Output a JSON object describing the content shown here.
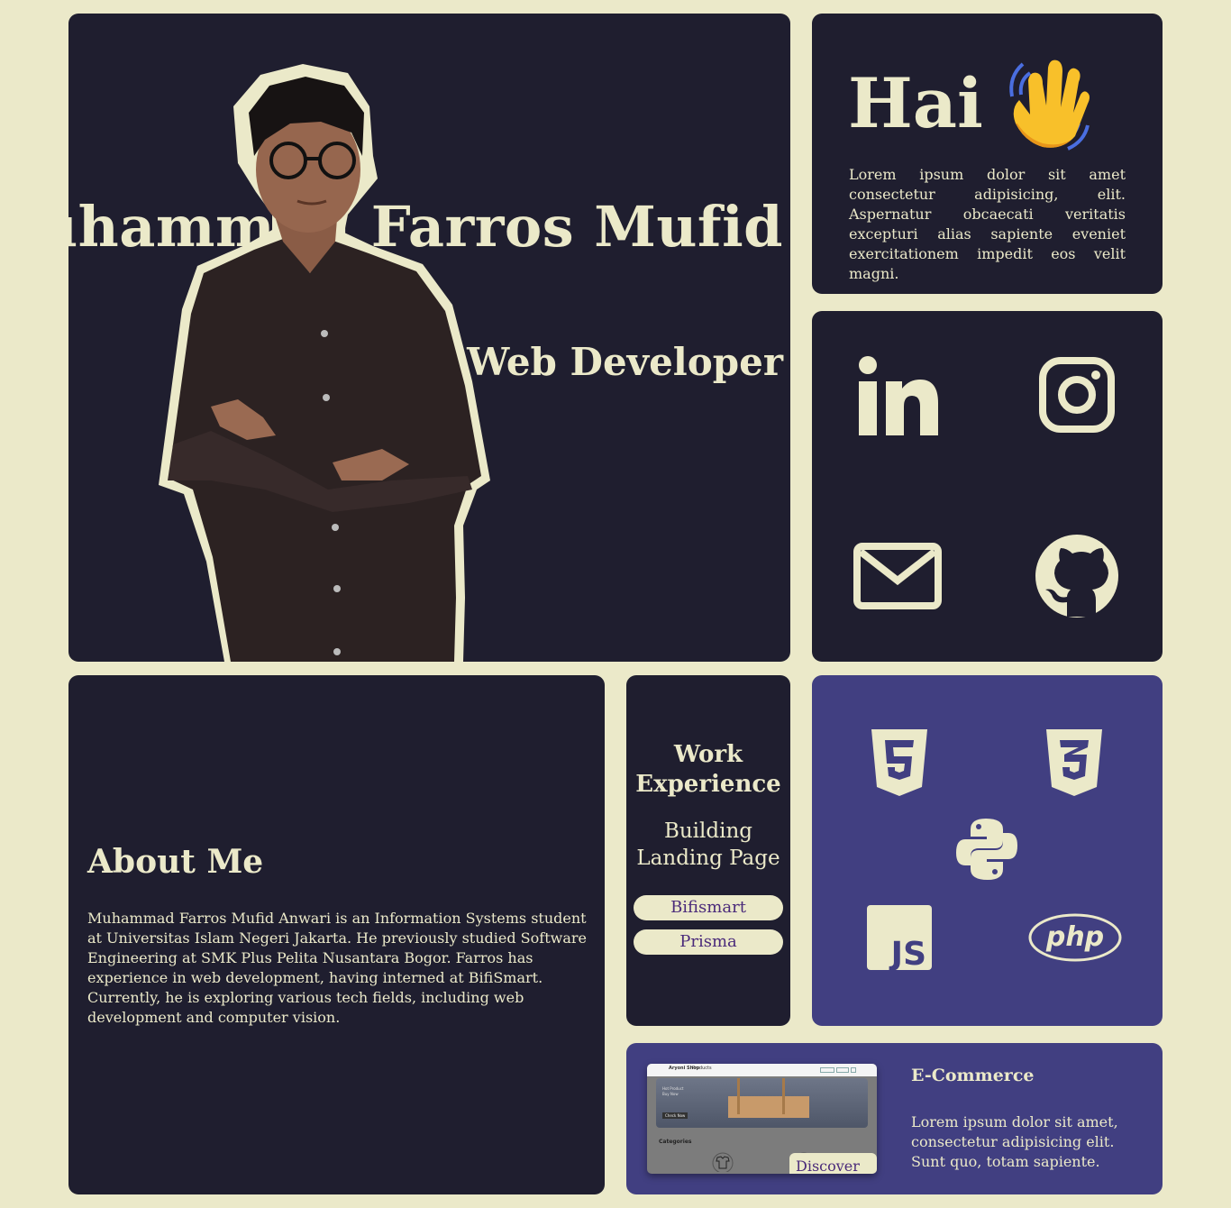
{
  "hero": {
    "name": "Muhammad Farros Mufid",
    "role": "Junior Web Developer"
  },
  "greeting": {
    "title": "Hai",
    "emoji": "waving-hand-icon",
    "text": "Lorem ipsum dolor sit amet consectetur adipisicing, elit. Aspernatur obcaecati veritatis excepturi alias sapiente eveniet exercitationem impedit eos velit magni."
  },
  "socials": [
    "linkedin-icon",
    "instagram-icon",
    "email-icon",
    "github-icon"
  ],
  "about": {
    "heading": "About Me",
    "text": "Muhammad Farros Mufid Anwari is an Information Systems student at Universitas Islam Negeri Jakarta. He previously studied Software Engineering at SMK Plus Pelita Nusantara Bogor. Farros has experience in web development, having interned at BifiSmart. Currently, he is exploring various tech fields, including web development and computer vision."
  },
  "work": {
    "heading": "Work Experience",
    "project": "Building Landing Page",
    "companies": [
      "Bifismart",
      "Prisma"
    ]
  },
  "tech": [
    "html5-icon",
    "css3-icon",
    "python-icon",
    "javascript-icon",
    "php-icon"
  ],
  "project": {
    "title": "E-Commerce",
    "text": "Lorem ipsum dolor sit amet, consectetur adipisicing elit. Sunt quo, totam sapiente.",
    "button": "Discover It",
    "screenshot": {
      "brand": "Aryoni Shop",
      "nav": "Products",
      "hero_line1": "Hot Product",
      "hero_line2": "Buy Now",
      "hero_button": "Check Now",
      "section": "Categories"
    }
  },
  "colors": {
    "background": "#ebe9c9",
    "card_dark": "#1f1e2f",
    "card_purple": "#413f81",
    "text_cream": "#ebe9c9",
    "pill_text": "#4a2a7a"
  }
}
